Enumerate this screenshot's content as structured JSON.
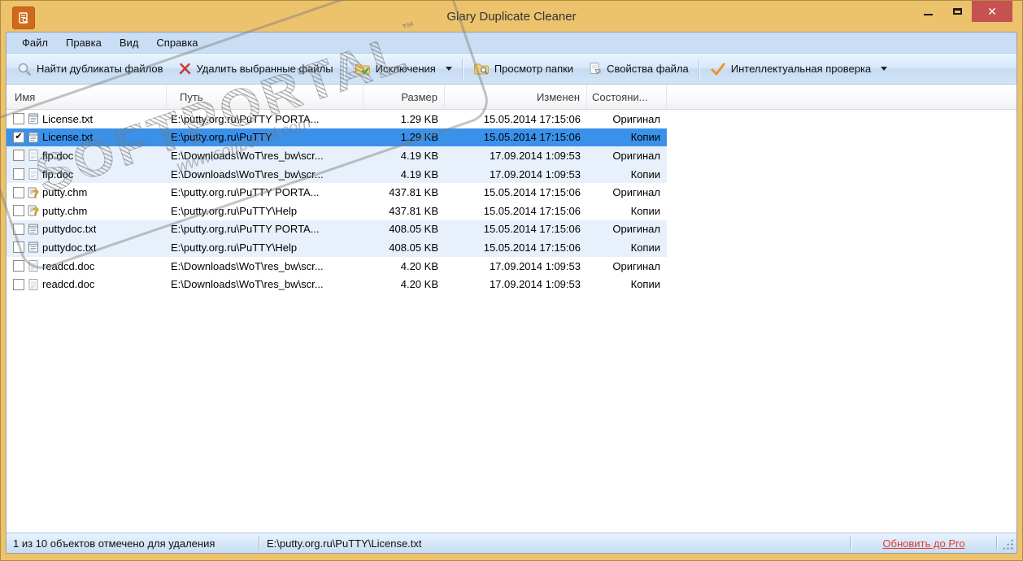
{
  "window": {
    "title": "Glary Duplicate Cleaner"
  },
  "menu": {
    "items": [
      {
        "label": "Файл"
      },
      {
        "label": "Правка"
      },
      {
        "label": "Вид"
      },
      {
        "label": "Справка"
      }
    ]
  },
  "toolbar": {
    "buttons": [
      {
        "label": "Найти дубликаты файлов",
        "icon": "search-icon"
      },
      {
        "label": "Удалить выбранные файлы",
        "icon": "delete-icon"
      },
      {
        "label": "Исключения",
        "icon": "folder-check-icon",
        "dropdown": true
      },
      {
        "label": "Просмотр папки",
        "icon": "folder-view-icon"
      },
      {
        "label": "Свойства файла",
        "icon": "file-properties-icon"
      },
      {
        "label": "Интеллектуальная проверка",
        "icon": "smart-check-icon",
        "dropdown": true
      }
    ]
  },
  "table": {
    "columns": [
      "Имя",
      "Путь",
      "Размер",
      "Изменен",
      "Состояни..."
    ],
    "rows": [
      {
        "checked": false,
        "selected": false,
        "stripe": false,
        "icon": "txt-file-icon",
        "name": "License.txt",
        "path": "E:\\putty.org.ru\\PuTTY PORTA...",
        "size": "1.29 KB",
        "modified": "15.05.2014 17:15:06",
        "status": "Оригинал"
      },
      {
        "checked": true,
        "selected": true,
        "stripe": false,
        "icon": "txt-file-icon",
        "name": "License.txt",
        "path": "E:\\putty.org.ru\\PuTTY",
        "size": "1.29 KB",
        "modified": "15.05.2014 17:15:06",
        "status": "Копии"
      },
      {
        "checked": false,
        "selected": false,
        "stripe": true,
        "icon": "doc-file-icon",
        "name": "flp.doc",
        "path": "E:\\Downloads\\WoT\\res_bw\\scr...",
        "size": "4.19 KB",
        "modified": "17.09.2014 1:09:53",
        "status": "Оригинал"
      },
      {
        "checked": false,
        "selected": false,
        "stripe": true,
        "icon": "doc-file-icon",
        "name": "flp.doc",
        "path": "E:\\Downloads\\WoT\\res_bw\\scr...",
        "size": "4.19 KB",
        "modified": "17.09.2014 1:09:53",
        "status": "Копии"
      },
      {
        "checked": false,
        "selected": false,
        "stripe": false,
        "icon": "chm-file-icon",
        "name": "putty.chm",
        "path": "E:\\putty.org.ru\\PuTTY PORTA...",
        "size": "437.81 KB",
        "modified": "15.05.2014 17:15:06",
        "status": "Оригинал"
      },
      {
        "checked": false,
        "selected": false,
        "stripe": false,
        "icon": "chm-file-icon",
        "name": "putty.chm",
        "path": "E:\\putty.org.ru\\PuTTY\\Help",
        "size": "437.81 KB",
        "modified": "15.05.2014 17:15:06",
        "status": "Копии"
      },
      {
        "checked": false,
        "selected": false,
        "stripe": true,
        "icon": "txt-file-icon",
        "name": "puttydoc.txt",
        "path": "E:\\putty.org.ru\\PuTTY PORTA...",
        "size": "408.05 KB",
        "modified": "15.05.2014 17:15:06",
        "status": "Оригинал"
      },
      {
        "checked": false,
        "selected": false,
        "stripe": true,
        "icon": "txt-file-icon",
        "name": "puttydoc.txt",
        "path": "E:\\putty.org.ru\\PuTTY\\Help",
        "size": "408.05 KB",
        "modified": "15.05.2014 17:15:06",
        "status": "Копии"
      },
      {
        "checked": false,
        "selected": false,
        "stripe": false,
        "icon": "doc-file-icon",
        "name": "readcd.doc",
        "path": "E:\\Downloads\\WoT\\res_bw\\scr...",
        "size": "4.20 KB",
        "modified": "17.09.2014 1:09:53",
        "status": "Оригинал"
      },
      {
        "checked": false,
        "selected": false,
        "stripe": false,
        "icon": "doc-file-icon",
        "name": "readcd.doc",
        "path": "E:\\Downloads\\WoT\\res_bw\\scr...",
        "size": "4.20 KB",
        "modified": "17.09.2014 1:09:53",
        "status": "Копии"
      }
    ]
  },
  "statusbar": {
    "selected_info": "1 из 10 объектов отмечено для удаления",
    "current_file": "E:\\putty.org.ru\\PuTTY\\License.txt",
    "upgrade_link": "Обновить до Pro"
  },
  "watermark": {
    "brand": "SOFTPORTAL",
    "tm": "™",
    "url": "www.softportal.com"
  },
  "colors": {
    "titlebar": "#ecc26c",
    "close_button": "#c75050",
    "menubar": "#c9def5",
    "selected_row": "#3a91ea",
    "stripe_row": "#e7f0fb",
    "upgrade_link": "#e03c31"
  }
}
